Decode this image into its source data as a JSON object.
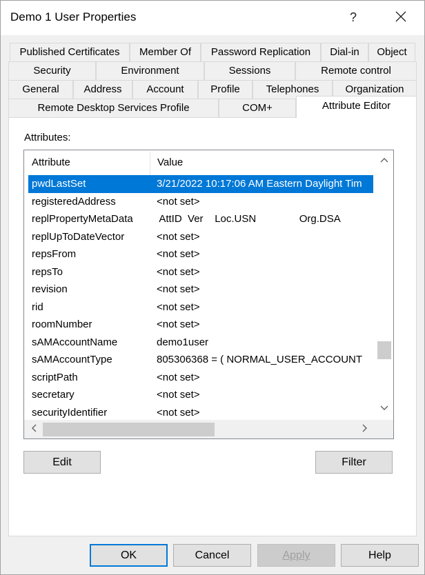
{
  "window": {
    "title": "Demo 1 User Properties",
    "help_glyph": "?",
    "close_icon": "close-icon"
  },
  "tabs": {
    "row1": [
      "Published Certificates",
      "Member Of",
      "Password Replication",
      "Dial-in",
      "Object"
    ],
    "row2": [
      "Security",
      "Environment",
      "Sessions",
      "Remote control"
    ],
    "row3": [
      "General",
      "Address",
      "Account",
      "Profile",
      "Telephones",
      "Organization"
    ],
    "row4": [
      "Remote Desktop Services Profile",
      "COM+",
      "Attribute Editor"
    ],
    "selected": "Attribute Editor"
  },
  "attributes": {
    "label": "Attributes:",
    "columns": [
      "Attribute",
      "Value"
    ],
    "rows": [
      {
        "attribute": "pwdLastSet",
        "value": "3/21/2022 10:17:06 AM Eastern Daylight Tim",
        "selected": true
      },
      {
        "attribute": "registeredAddress",
        "value": "<not set>"
      },
      {
        "attribute": "replPropertyMetaData",
        "value": " AttID  Ver    Loc.USN               Org.DSA"
      },
      {
        "attribute": "replUpToDateVector",
        "value": "<not set>"
      },
      {
        "attribute": "repsFrom",
        "value": "<not set>"
      },
      {
        "attribute": "repsTo",
        "value": "<not set>"
      },
      {
        "attribute": "revision",
        "value": "<not set>"
      },
      {
        "attribute": "rid",
        "value": "<not set>"
      },
      {
        "attribute": "roomNumber",
        "value": "<not set>"
      },
      {
        "attribute": "sAMAccountName",
        "value": "demo1user"
      },
      {
        "attribute": "sAMAccountType",
        "value": "805306368 = ( NORMAL_USER_ACCOUNT"
      },
      {
        "attribute": "scriptPath",
        "value": "<not set>"
      },
      {
        "attribute": "secretary",
        "value": "<not set>"
      },
      {
        "attribute": "securityIdentifier",
        "value": "<not set>"
      }
    ],
    "edit_label": "Edit",
    "filter_label": "Filter"
  },
  "footer": {
    "ok": "OK",
    "cancel": "Cancel",
    "apply": "Apply",
    "help": "Help"
  },
  "colors": {
    "selection": "#0078d7",
    "background": "#f0f0f0"
  }
}
